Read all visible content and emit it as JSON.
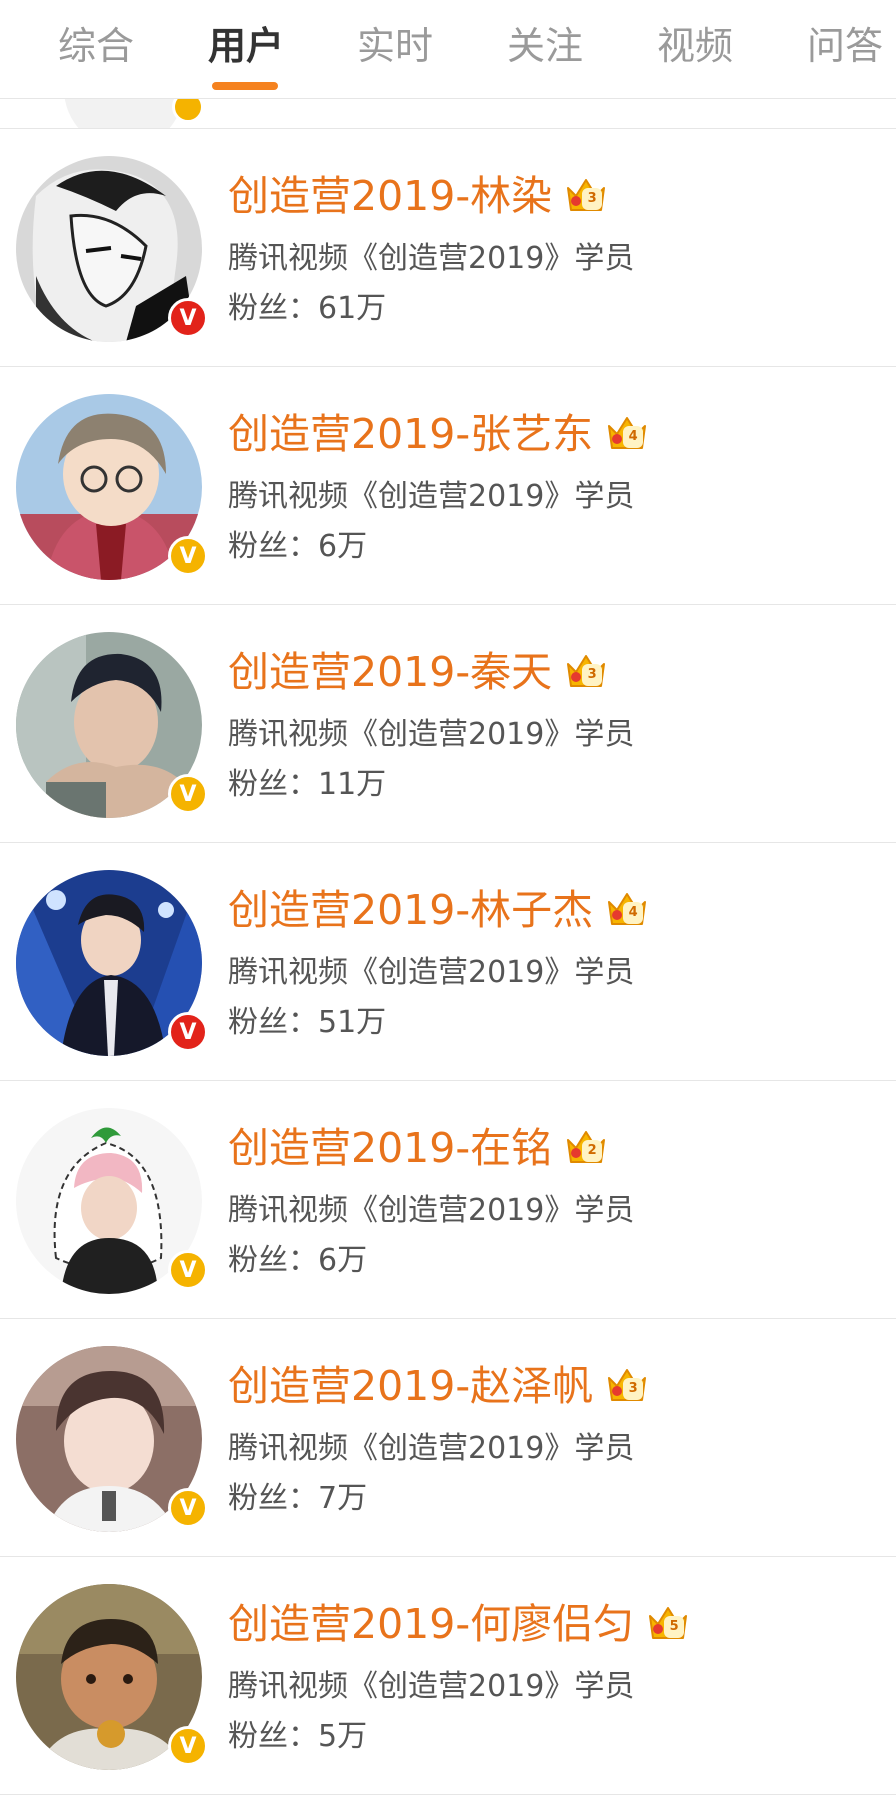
{
  "tabs": [
    {
      "label": "综合",
      "active": false
    },
    {
      "label": "用户",
      "active": true
    },
    {
      "label": "实时",
      "active": false
    },
    {
      "label": "关注",
      "active": false
    },
    {
      "label": "视频",
      "active": false
    },
    {
      "label": "问答",
      "active": false
    }
  ],
  "colors": {
    "accent": "#f5821f",
    "name_orange": "#e8731b",
    "badge_red": "#e2231a",
    "badge_gold": "#f5b300",
    "crown_gold": "#f7b500"
  },
  "fans_prefix": "粉丝：",
  "users": [
    {
      "name": "创造营2019-林染",
      "desc": "腾讯视频《创造营2019》学员",
      "fans": "61万",
      "badge": "red",
      "badge_glyph": "V",
      "crown_level": "3",
      "crown_icon": "crown-icon"
    },
    {
      "name": "创造营2019-张艺东",
      "desc": "腾讯视频《创造营2019》学员",
      "fans": "6万",
      "badge": "gold",
      "badge_glyph": "V",
      "crown_level": "4",
      "crown_icon": "crown-icon"
    },
    {
      "name": "创造营2019-秦天",
      "desc": "腾讯视频《创造营2019》学员",
      "fans": "11万",
      "badge": "gold",
      "badge_glyph": "V",
      "crown_level": "3",
      "crown_icon": "crown-icon"
    },
    {
      "name": "创造营2019-林子杰",
      "desc": "腾讯视频《创造营2019》学员",
      "fans": "51万",
      "badge": "red",
      "badge_glyph": "V",
      "crown_level": "4",
      "crown_icon": "crown-icon"
    },
    {
      "name": "创造营2019-在铭",
      "desc": "腾讯视频《创造营2019》学员",
      "fans": "6万",
      "badge": "gold",
      "badge_glyph": "V",
      "crown_level": "2",
      "crown_icon": "crown-icon"
    },
    {
      "name": "创造营2019-赵泽帆",
      "desc": "腾讯视频《创造营2019》学员",
      "fans": "7万",
      "badge": "gold",
      "badge_glyph": "V",
      "crown_level": "3",
      "crown_icon": "crown-icon"
    },
    {
      "name": "创造营2019-何廖侣匀",
      "desc": "腾讯视频《创造营2019》学员",
      "fans": "5万",
      "badge": "gold",
      "badge_glyph": "V",
      "crown_level": "5",
      "crown_icon": "crown-icon"
    }
  ]
}
